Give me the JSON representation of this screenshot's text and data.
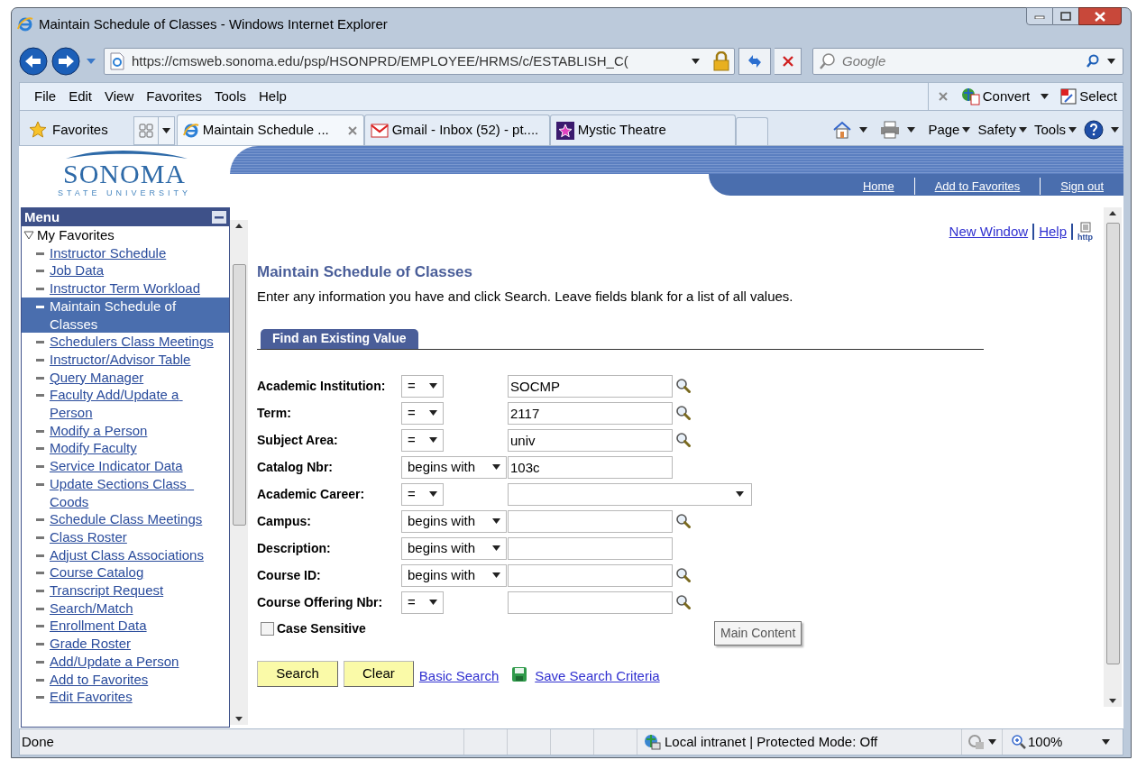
{
  "window": {
    "title": "Maintain Schedule of Classes - Windows Internet Explorer"
  },
  "address_bar": {
    "url": "https://cmsweb.sonoma.edu/psp/HSONPRD/EMPLOYEE/HRMS/c/ESTABLISH_C("
  },
  "search_box": {
    "placeholder": "Google"
  },
  "menu_bar": [
    "File",
    "Edit",
    "View",
    "Favorites",
    "Tools",
    "Help"
  ],
  "addon_bar": [
    "Convert",
    "Select"
  ],
  "favorites_button": "Favorites",
  "tabs": [
    {
      "label": "Maintain Schedule ...",
      "kind": "ie",
      "selected": true
    },
    {
      "label": "Gmail - Inbox (52) - pt....",
      "kind": "gmail",
      "selected": false
    },
    {
      "label": "Mystic Theatre",
      "kind": "star",
      "selected": false
    }
  ],
  "command_bar": [
    "Page",
    "Safety",
    "Tools"
  ],
  "header": {
    "logo": "SONOMA",
    "logo_subtitle": "STATE UNIVERSITY",
    "links": [
      "Home",
      "Add to Favorites",
      "Sign out"
    ]
  },
  "menu": {
    "title": "Menu",
    "folder": "My Favorites",
    "expanded": true,
    "items": [
      {
        "label": "Instructor Schedule",
        "selected": false
      },
      {
        "label": "Job Data",
        "selected": false
      },
      {
        "label": "Instructor Term Workload",
        "selected": false
      },
      {
        "label": "Maintain Schedule of Classes",
        "selected": true
      },
      {
        "label": "Schedulers Class Meetings",
        "selected": false
      },
      {
        "label": "Instructor/Advisor Table",
        "selected": false
      },
      {
        "label": "Query Manager",
        "selected": false
      },
      {
        "label": "Faculty Add/Update a Person",
        "selected": false
      },
      {
        "label": "Modify a Person",
        "selected": false
      },
      {
        "label": "Modify Faculty",
        "selected": false
      },
      {
        "label": "Service Indicator Data",
        "selected": false
      },
      {
        "label": "Update Sections Class  Coods",
        "selected": false
      },
      {
        "label": "Schedule Class Meetings",
        "selected": false
      },
      {
        "label": "Class Roster",
        "selected": false
      },
      {
        "label": "Adjust Class Associations",
        "selected": false
      },
      {
        "label": "Course Catalog",
        "selected": false
      },
      {
        "label": "Transcript Request",
        "selected": false
      },
      {
        "label": "Search/Match",
        "selected": false
      },
      {
        "label": "Enrollment Data",
        "selected": false
      },
      {
        "label": "Grade Roster",
        "selected": false
      },
      {
        "label": "Add/Update a Person",
        "selected": false
      },
      {
        "label": "Add to Favorites",
        "selected": false
      },
      {
        "label": "Edit Favorites",
        "selected": false
      }
    ]
  },
  "page": {
    "top_links": [
      "New Window",
      "Help"
    ],
    "http_icon_text": "http",
    "title": "Maintain Schedule of Classes",
    "instructions": "Enter any information you have and click Search. Leave fields blank for a list of all values.",
    "search_tab": "Find an Existing Value",
    "fields": [
      {
        "label": "Academic Institution:",
        "operator": "=",
        "kind": "text",
        "value": "SOCMP",
        "lookup": true
      },
      {
        "label": "Term:",
        "operator": "=",
        "kind": "text",
        "value": "2117",
        "lookup": true
      },
      {
        "label": "Subject Area:",
        "operator": "=",
        "kind": "text",
        "value": "univ",
        "lookup": true
      },
      {
        "label": "Catalog Nbr:",
        "operator": "begins with",
        "kind": "text",
        "value": "103c",
        "lookup": false
      },
      {
        "label": "Academic Career:",
        "operator": "=",
        "kind": "dropdown",
        "lookup": false
      },
      {
        "label": "Campus:",
        "operator": "begins with",
        "kind": "text",
        "lookup": true
      },
      {
        "label": "Description:",
        "operator": "begins with",
        "kind": "text",
        "lookup": false
      },
      {
        "label": "Course ID:",
        "operator": "begins with",
        "kind": "text",
        "lookup": true
      },
      {
        "label": "Course Offering Nbr:",
        "operator": "=",
        "kind": "text",
        "lookup": true
      }
    ],
    "case_sensitive": {
      "label": "Case Sensitive",
      "checked": false
    },
    "buttons": [
      "Search",
      "Clear"
    ],
    "links": [
      "Basic Search",
      "Save Search Criteria"
    ],
    "tooltip": "Main Content"
  },
  "status_bar": {
    "text": "Done",
    "zone": "Local intranet | Protected Mode: Off",
    "zoom": "100%"
  }
}
